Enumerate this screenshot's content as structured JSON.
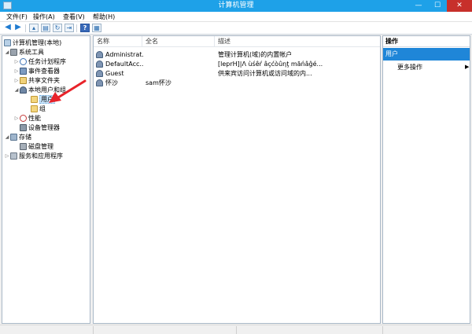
{
  "window": {
    "title": "计算机管理"
  },
  "menu": {
    "items": [
      "文件(F)",
      "操作(A)",
      "查看(V)",
      "帮助(H)"
    ]
  },
  "tree": {
    "items": [
      {
        "label": "计算机管理(本地)",
        "icon": "computer-icon",
        "level": 0,
        "twisty": ""
      },
      {
        "label": "系统工具",
        "icon": "tools-icon",
        "level": 1,
        "twisty": "◢"
      },
      {
        "label": "任务计划程序",
        "icon": "clock-icon",
        "level": 2,
        "twisty": "▷"
      },
      {
        "label": "事件查看器",
        "icon": "event-viewer-icon",
        "level": 2,
        "twisty": "▷"
      },
      {
        "label": "共享文件夹",
        "icon": "shared-folder-icon",
        "level": 2,
        "twisty": "▷"
      },
      {
        "label": "本地用户和组",
        "icon": "users-group-icon",
        "level": 2,
        "twisty": "◢"
      },
      {
        "label": "用户",
        "icon": "folder-icon",
        "level": 3,
        "twisty": "",
        "selected": true
      },
      {
        "label": "组",
        "icon": "folder-icon",
        "level": 3,
        "twisty": ""
      },
      {
        "label": "性能",
        "icon": "performance-icon",
        "level": 2,
        "twisty": "▷"
      },
      {
        "label": "设备管理器",
        "icon": "device-manager-icon",
        "level": 2,
        "twisty": ""
      },
      {
        "label": "存储",
        "icon": "storage-icon",
        "level": 1,
        "twisty": "◢"
      },
      {
        "label": "磁盘管理",
        "icon": "disk-icon",
        "level": 2,
        "twisty": ""
      },
      {
        "label": "服务和应用程序",
        "icon": "services-icon",
        "level": 1,
        "twisty": "▷"
      }
    ]
  },
  "list": {
    "columns": [
      "名称",
      "全名",
      "描述"
    ],
    "rows": [
      {
        "name": "Administrat...",
        "fullname": "",
        "description": "管理计算机(域)的内置帐户"
      },
      {
        "name": "DefaultAcc...",
        "fullname": "",
        "description": "[leprH]|Λ ùśêŕ âçćòûηţ măńâĝé..."
      },
      {
        "name": "Guest",
        "fullname": "",
        "description": "供来宾访问计算机或访问域的内..."
      },
      {
        "name": "怀沙",
        "fullname": "sam怀沙",
        "description": ""
      }
    ]
  },
  "actions": {
    "header": "操作",
    "section": "用户",
    "item": "更多操作",
    "item_arrow": "▶"
  },
  "colors": {
    "titlebar": "#1ea1e8",
    "selection": "#1f86d8",
    "annotation_arrow": "#e8232a"
  }
}
